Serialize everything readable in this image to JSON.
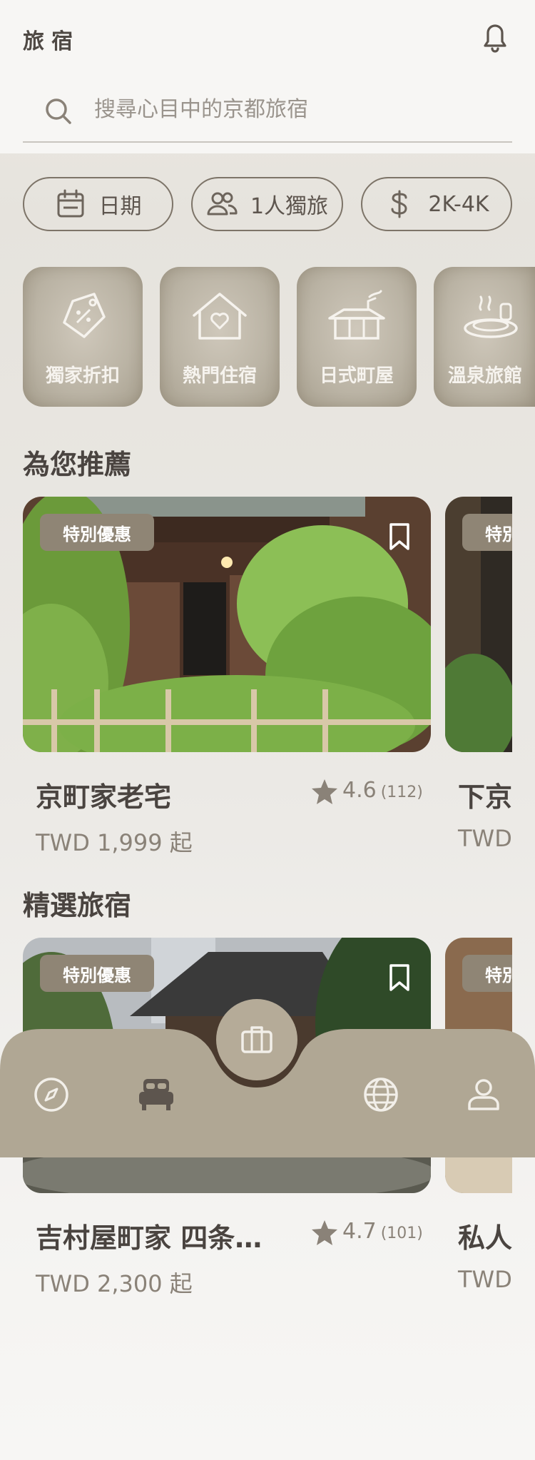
{
  "app": {
    "title": "旅宿"
  },
  "search": {
    "placeholder": "搜尋心目中的京都旅宿"
  },
  "filters": {
    "date": "日期",
    "guests": "1人獨旅",
    "price": "2K-4K"
  },
  "categories": [
    {
      "label": "獨家折扣",
      "icon": "discount-tag-icon"
    },
    {
      "label": "熱門住宿",
      "icon": "heart-house-icon"
    },
    {
      "label": "日式町屋",
      "icon": "machiya-house-icon"
    },
    {
      "label": "溫泉旅館",
      "icon": "onsen-icon"
    }
  ],
  "recommended": {
    "title": "為您推薦",
    "cards": [
      {
        "badge": "特別優惠",
        "name": "京町家老宅",
        "rating": "4.6",
        "count": "(112)",
        "price": "TWD 1,999 起"
      },
      {
        "badge": "特別優惠",
        "name": "下京",
        "price": "TWD"
      }
    ]
  },
  "featured": {
    "title": "精選旅宿",
    "cards": [
      {
        "badge": "特別優惠",
        "name": "吉村屋町家 四条…",
        "rating": "4.7",
        "count": "(101)",
        "price": "TWD 2,300 起"
      },
      {
        "badge": "特別優惠",
        "name": "私人",
        "price": "TWD"
      }
    ]
  },
  "tabbar": {
    "items": [
      "compass-icon",
      "bed-icon",
      "luggage-icon",
      "globe-icon",
      "user-icon"
    ],
    "active": "bed-icon"
  },
  "colors": {
    "accent": "#8f8575",
    "tabbar": "#b0a794",
    "text": "#4a4440"
  }
}
